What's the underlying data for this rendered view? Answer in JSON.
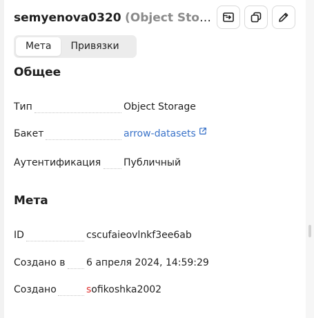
{
  "header": {
    "name": "semyenova0320",
    "kind": "(Object Storag..."
  },
  "toolbar": {
    "buttons": [
      {
        "icon": "open-in-panel-icon"
      },
      {
        "icon": "copy-icon"
      },
      {
        "icon": "edit-pencil-icon"
      }
    ]
  },
  "tabs": [
    {
      "label": "Мета",
      "active": true
    },
    {
      "label": "Привязки",
      "active": false
    }
  ],
  "general": {
    "title": "Общее",
    "rows": [
      {
        "label": "Тип",
        "value": "Object Storage"
      },
      {
        "label": "Бакет",
        "value": "arrow-datasets",
        "link": true
      },
      {
        "label": "Аутентификация",
        "value": "Публичный"
      }
    ]
  },
  "meta": {
    "title": "Мета",
    "rows": [
      {
        "label": "ID",
        "value": "cscufaieovlnkf3ee6ab"
      },
      {
        "label": "Создано в",
        "value": "6 апреля 2024, 14:59:29"
      },
      {
        "label": "Создано",
        "value_first": "s",
        "value_rest": "ofikoshka2002"
      }
    ]
  },
  "colors": {
    "link": "#3a73c9",
    "accent_letter": "#e0302e",
    "panel_bg": "#ffffff",
    "page_bg": "#f2f2f2"
  }
}
